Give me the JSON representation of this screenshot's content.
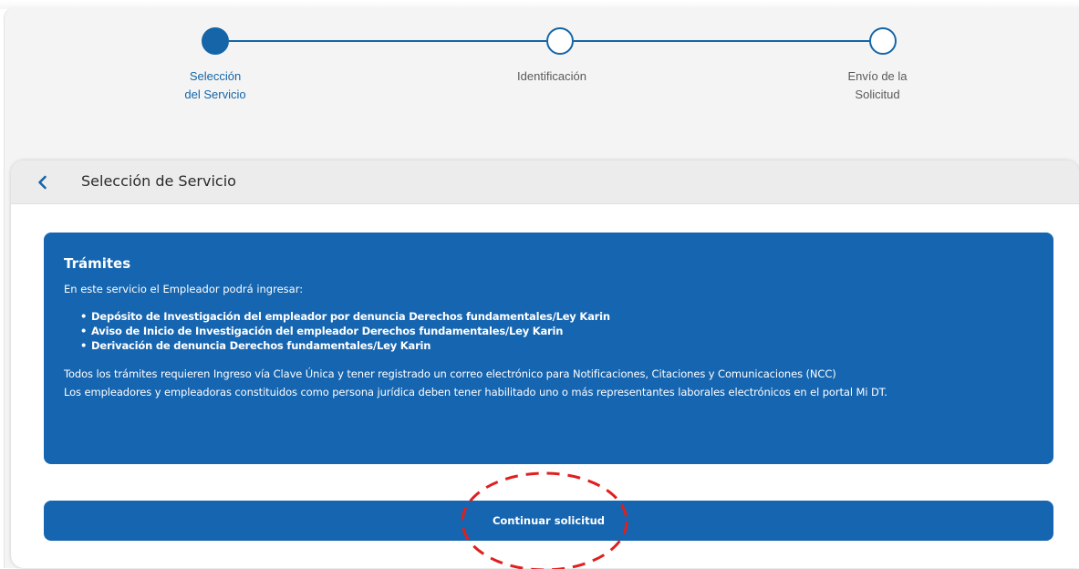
{
  "stepper": {
    "steps": [
      {
        "label": "Selección\ndel Servicio",
        "state": "active"
      },
      {
        "label": "Identificación",
        "state": "pending"
      },
      {
        "label": "Envío de la\nSolicitud",
        "state": "pending"
      }
    ],
    "accent_color": "#1565a8"
  },
  "card": {
    "title": "Selección de Servicio",
    "back_icon": "chevron-left-icon"
  },
  "info_panel": {
    "title": "Trámites",
    "intro": "En este servicio el Empleador podrá ingresar:",
    "items": [
      "Depósito de Investigación del empleador por denuncia Derechos fundamentales/Ley Karin",
      "Aviso de Inicio de Investigación del empleador Derechos fundamentales/Ley Karin",
      "Derivación de denuncia Derechos fundamentales/Ley Karin"
    ],
    "paragraph_1": "Todos los trámites requieren Ingreso vía Clave Única y tener registrado un correo electrónico para Notificaciones, Citaciones y Comunicaciones (NCC)",
    "paragraph_2": "Los empleadores y empleadoras constituidos como persona jurídica deben tener habilitado uno o más representantes laborales electrónicos en el portal Mi DT.",
    "background_color": "#1565b0"
  },
  "actions": {
    "continue_label": "Continuar solicitud"
  },
  "annotation": {
    "shape": "dashed-ellipse",
    "color": "#e02020"
  }
}
